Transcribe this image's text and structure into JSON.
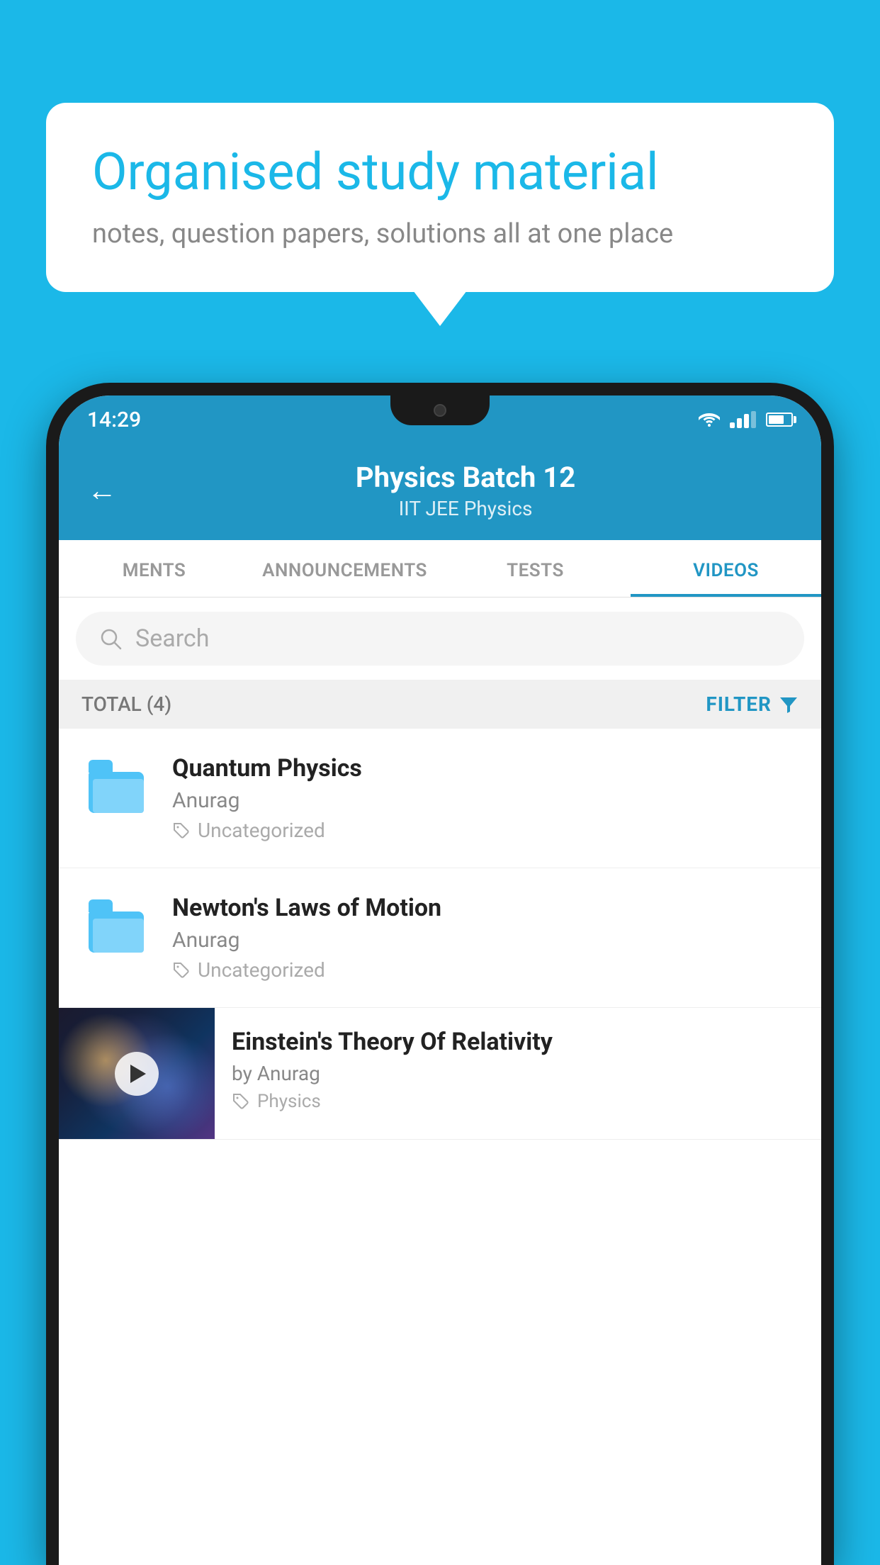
{
  "background": {
    "color": "#1bb8e8"
  },
  "speech_bubble": {
    "title": "Organised study material",
    "subtitle": "notes, question papers, solutions all at one place"
  },
  "status_bar": {
    "time": "14:29",
    "wifi": "▲",
    "battery_percent": 70
  },
  "app_header": {
    "back_label": "←",
    "title": "Physics Batch 12",
    "subtitle": "IIT JEE   Physics"
  },
  "tabs": {
    "items": [
      {
        "label": "MENTS",
        "active": false
      },
      {
        "label": "ANNOUNCEMENTS",
        "active": false
      },
      {
        "label": "TESTS",
        "active": false
      },
      {
        "label": "VIDEOS",
        "active": true
      }
    ]
  },
  "search": {
    "placeholder": "Search"
  },
  "filter_bar": {
    "total_label": "TOTAL (4)",
    "filter_label": "FILTER"
  },
  "videos": [
    {
      "id": 1,
      "title": "Quantum Physics",
      "author": "Anurag",
      "tag": "Uncategorized",
      "type": "folder"
    },
    {
      "id": 2,
      "title": "Newton's Laws of Motion",
      "author": "Anurag",
      "tag": "Uncategorized",
      "type": "folder"
    },
    {
      "id": 3,
      "title": "Einstein's Theory Of Relativity",
      "author": "by Anurag",
      "tag": "Physics",
      "type": "video"
    }
  ]
}
